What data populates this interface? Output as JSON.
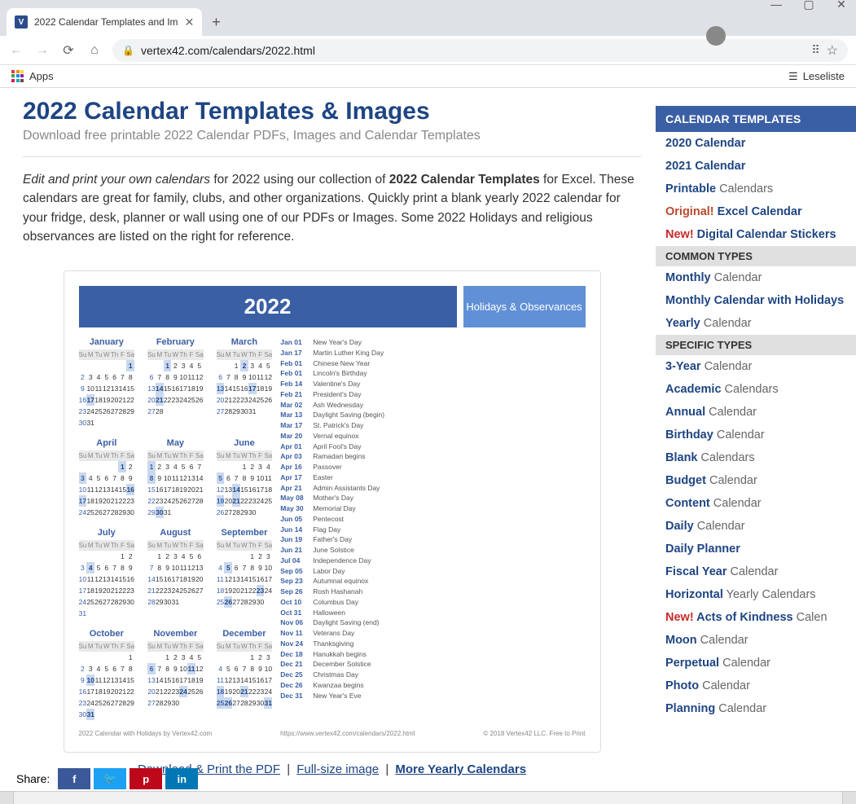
{
  "browser": {
    "tab_title": "2022 Calendar Templates and Im",
    "url": "vertex42.com/calendars/2022.html",
    "apps_label": "Apps",
    "reading_list_label": "Leseliste"
  },
  "page": {
    "title": "2022 Calendar Templates & Images",
    "subtitle": "Download free printable 2022 Calendar PDFs, Images and Calendar Templates",
    "intro_italic": "Edit and print your own calendars",
    "intro_p1a": " for 2022 using our collection of ",
    "intro_bold": "2022 Calendar Templates",
    "intro_p1b": " for Excel. These calendars are great for family, clubs, and other organizations. Quickly print a blank yearly 2022 calendar for your fridge, desk, planner or wall using one of our PDFs or Images. Some 2022 Holidays and religious observances are listed on the right for reference."
  },
  "calendar": {
    "year": "2022",
    "hol_header": "Holidays & Observances",
    "dow": [
      "Su",
      "M",
      "Tu",
      "W",
      "Th",
      "F",
      "Sa"
    ],
    "months": [
      {
        "name": "January",
        "start": 6,
        "days": 31,
        "hl": [
          1,
          17
        ]
      },
      {
        "name": "February",
        "start": 2,
        "days": 28,
        "hl": [
          1,
          14,
          21
        ]
      },
      {
        "name": "March",
        "start": 2,
        "days": 31,
        "hl": [
          2,
          13,
          17
        ]
      },
      {
        "name": "April",
        "start": 5,
        "days": 30,
        "hl": [
          1,
          3,
          16,
          17
        ]
      },
      {
        "name": "May",
        "start": 0,
        "days": 31,
        "hl": [
          1,
          8,
          30
        ]
      },
      {
        "name": "June",
        "start": 3,
        "days": 30,
        "hl": [
          5,
          14,
          19,
          21
        ]
      },
      {
        "name": "July",
        "start": 5,
        "days": 31,
        "hl": [
          4
        ]
      },
      {
        "name": "August",
        "start": 1,
        "days": 31,
        "hl": []
      },
      {
        "name": "September",
        "start": 4,
        "days": 30,
        "hl": [
          5,
          23,
          26
        ]
      },
      {
        "name": "October",
        "start": 6,
        "days": 31,
        "hl": [
          10,
          31
        ]
      },
      {
        "name": "November",
        "start": 2,
        "days": 30,
        "hl": [
          6,
          11,
          24
        ]
      },
      {
        "name": "December",
        "start": 4,
        "days": 31,
        "hl": [
          18,
          21,
          25,
          26,
          31
        ]
      }
    ],
    "holidays": [
      {
        "d": "Jan 01",
        "n": "New Year's Day"
      },
      {
        "d": "Jan 17",
        "n": "Martin Luther King Day"
      },
      {
        "d": "Feb 01",
        "n": "Chinese New Year"
      },
      {
        "d": "Feb 01",
        "n": "Lincoln's Birthday"
      },
      {
        "d": "Feb 14",
        "n": "Valentine's Day"
      },
      {
        "d": "Feb 21",
        "n": "President's Day"
      },
      {
        "d": "Mar 02",
        "n": "Ash Wednesday"
      },
      {
        "d": "Mar 13",
        "n": "Daylight Saving (begin)"
      },
      {
        "d": "Mar 17",
        "n": "St. Patrick's Day"
      },
      {
        "d": "Mar 20",
        "n": "Vernal equinox"
      },
      {
        "d": "Apr 01",
        "n": "April Fool's Day"
      },
      {
        "d": "Apr 03",
        "n": "Ramadan begins"
      },
      {
        "d": "Apr 16",
        "n": "Passover"
      },
      {
        "d": "Apr 17",
        "n": "Easter"
      },
      {
        "d": "Apr 21",
        "n": "Admin Assistants Day"
      },
      {
        "d": "May 08",
        "n": "Mother's Day"
      },
      {
        "d": "May 30",
        "n": "Memorial Day"
      },
      {
        "d": "Jun 05",
        "n": "Pentecost"
      },
      {
        "d": "Jun 14",
        "n": "Flag Day"
      },
      {
        "d": "Jun 19",
        "n": "Father's Day"
      },
      {
        "d": "Jun 21",
        "n": "June Solstice"
      },
      {
        "d": "Jul 04",
        "n": "Independence Day"
      },
      {
        "d": "Sep 05",
        "n": "Labor Day"
      },
      {
        "d": "Sep 23",
        "n": "Autumnal equinox"
      },
      {
        "d": "Sep 26",
        "n": "Rosh Hashanah"
      },
      {
        "d": "Oct 10",
        "n": "Columbus Day"
      },
      {
        "d": "Oct 31",
        "n": "Halloween"
      },
      {
        "d": "Nov 06",
        "n": "Daylight Saving (end)"
      },
      {
        "d": "Nov 11",
        "n": "Veterans Day"
      },
      {
        "d": "Nov 24",
        "n": "Thanksgiving"
      },
      {
        "d": "Dec 18",
        "n": "Hanukkah begins"
      },
      {
        "d": "Dec 21",
        "n": "December Solstice"
      },
      {
        "d": "Dec 25",
        "n": "Christmas Day"
      },
      {
        "d": "Dec 26",
        "n": "Kwanzaa begins"
      },
      {
        "d": "Dec 31",
        "n": "New Year's Eve"
      }
    ],
    "footer_left": "2022 Calendar with Holidays by Vertex42.com",
    "footer_mid": "https://www.vertex42.com/calendars/2022.html",
    "footer_right": "© 2018 Vertex42 LLC. Free to Print"
  },
  "links": {
    "pdf": "Download & Print the PDF",
    "image": "Full-size image",
    "more": "More Yearly Calendars",
    "sep": "|"
  },
  "sidebar": {
    "header": "CALENDAR TEMPLATES",
    "main": [
      {
        "lead": "2020 Calendar",
        "tail": ""
      },
      {
        "lead": "2021 Calendar",
        "tail": ""
      },
      {
        "lead": "Printable",
        "tail": " Calendars"
      },
      {
        "badge": "orig",
        "blabel": "Original!",
        "lead": " Excel Calendar",
        "tail": ""
      },
      {
        "badge": "new",
        "blabel": "New!",
        "lead": " Digital Calendar Stickers",
        "tail": ""
      }
    ],
    "common_header": "COMMON TYPES",
    "common": [
      {
        "lead": "Monthly",
        "tail": " Calendar"
      },
      {
        "lead": "Monthly Calendar with Holidays",
        "tail": ""
      },
      {
        "lead": "Yearly",
        "tail": " Calendar"
      }
    ],
    "specific_header": "SPECIFIC TYPES",
    "specific": [
      {
        "lead": "3-Year",
        "tail": " Calendar"
      },
      {
        "lead": "Academic",
        "tail": " Calendars"
      },
      {
        "lead": "Annual",
        "tail": " Calendar"
      },
      {
        "lead": "Birthday",
        "tail": " Calendar"
      },
      {
        "lead": "Blank",
        "tail": " Calendars"
      },
      {
        "lead": "Budget",
        "tail": " Calendar"
      },
      {
        "lead": "Content",
        "tail": " Calendar"
      },
      {
        "lead": "Daily",
        "tail": " Calendar"
      },
      {
        "lead": "Daily Planner",
        "tail": ""
      },
      {
        "lead": "Fiscal Year",
        "tail": " Calendar"
      },
      {
        "lead": "Horizontal",
        "tail": " Yearly Calendars"
      },
      {
        "badge": "new",
        "blabel": "New!",
        "lead": " Acts of Kindness",
        "tail": " Calen"
      },
      {
        "lead": "Moon",
        "tail": " Calendar"
      },
      {
        "lead": "Perpetual",
        "tail": " Calendar"
      },
      {
        "lead": "Photo",
        "tail": " Calendar"
      },
      {
        "lead": "Planning",
        "tail": " Calendar"
      }
    ]
  },
  "share": {
    "label": "Share:"
  }
}
